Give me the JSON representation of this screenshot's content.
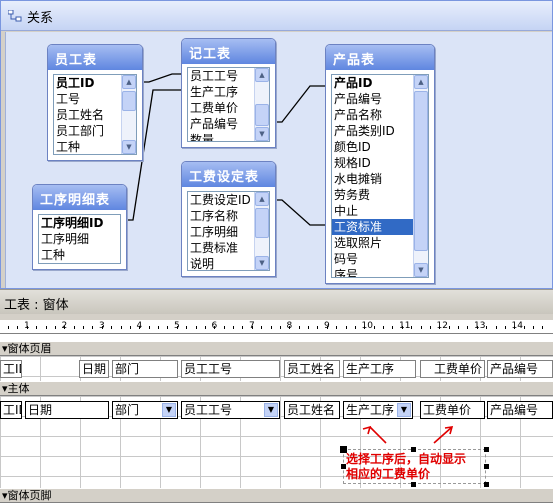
{
  "relationships": {
    "title": "关系",
    "tables": [
      {
        "name": "员工表",
        "fields": [
          "员工ID",
          "工号",
          "员工姓名",
          "员工部门",
          "工种"
        ],
        "pk": [
          0
        ]
      },
      {
        "name": "记工表",
        "fields": [
          "员工工号",
          "生产工序",
          "工费单价",
          "产品编号",
          "数量"
        ],
        "pk": []
      },
      {
        "name": "产品表",
        "fields": [
          "产品ID",
          "产品编号",
          "产品名称",
          "产品类别ID",
          "颜色ID",
          "规格ID",
          "水电摊销",
          "劳务费",
          "中止",
          "工资标准",
          "选取照片",
          "码号",
          "序号"
        ],
        "pk": [
          0
        ],
        "selected": 9
      },
      {
        "name": "工序明细表",
        "fields": [
          "工序明细ID",
          "工序明细",
          "工种"
        ],
        "pk": [
          0
        ]
      },
      {
        "name": "工费设定表",
        "fields": [
          "工费设定ID",
          "工序名称",
          "工序明细",
          "工费标准",
          "说明"
        ],
        "pk": []
      }
    ]
  },
  "form": {
    "title": "工表 : 窗体",
    "ruler_numbers": [
      "1",
      "2",
      "3",
      "4",
      "5",
      "6",
      "7",
      "8",
      "9",
      "10",
      "11",
      "12",
      "13",
      "14"
    ],
    "header_section": "窗体页眉",
    "detail_section": "主体",
    "footer_section": "窗体页脚",
    "header_labels": [
      "工ID",
      "日期",
      "部门",
      "员工工号",
      "员工姓名",
      "生产工序",
      "工费单价",
      "产品编号"
    ],
    "detail_controls": [
      "工ID",
      "日期",
      "部门",
      "员工工号",
      "员工姓名",
      "生产工序",
      "工费单价",
      "产品编号"
    ],
    "annotation_line1": "选择工序后，自动显示",
    "annotation_line2": "相应的工费单价"
  },
  "colors": {
    "selection": "#316ac5",
    "annotation": "#e00000",
    "table_header": "#5f86e0"
  }
}
